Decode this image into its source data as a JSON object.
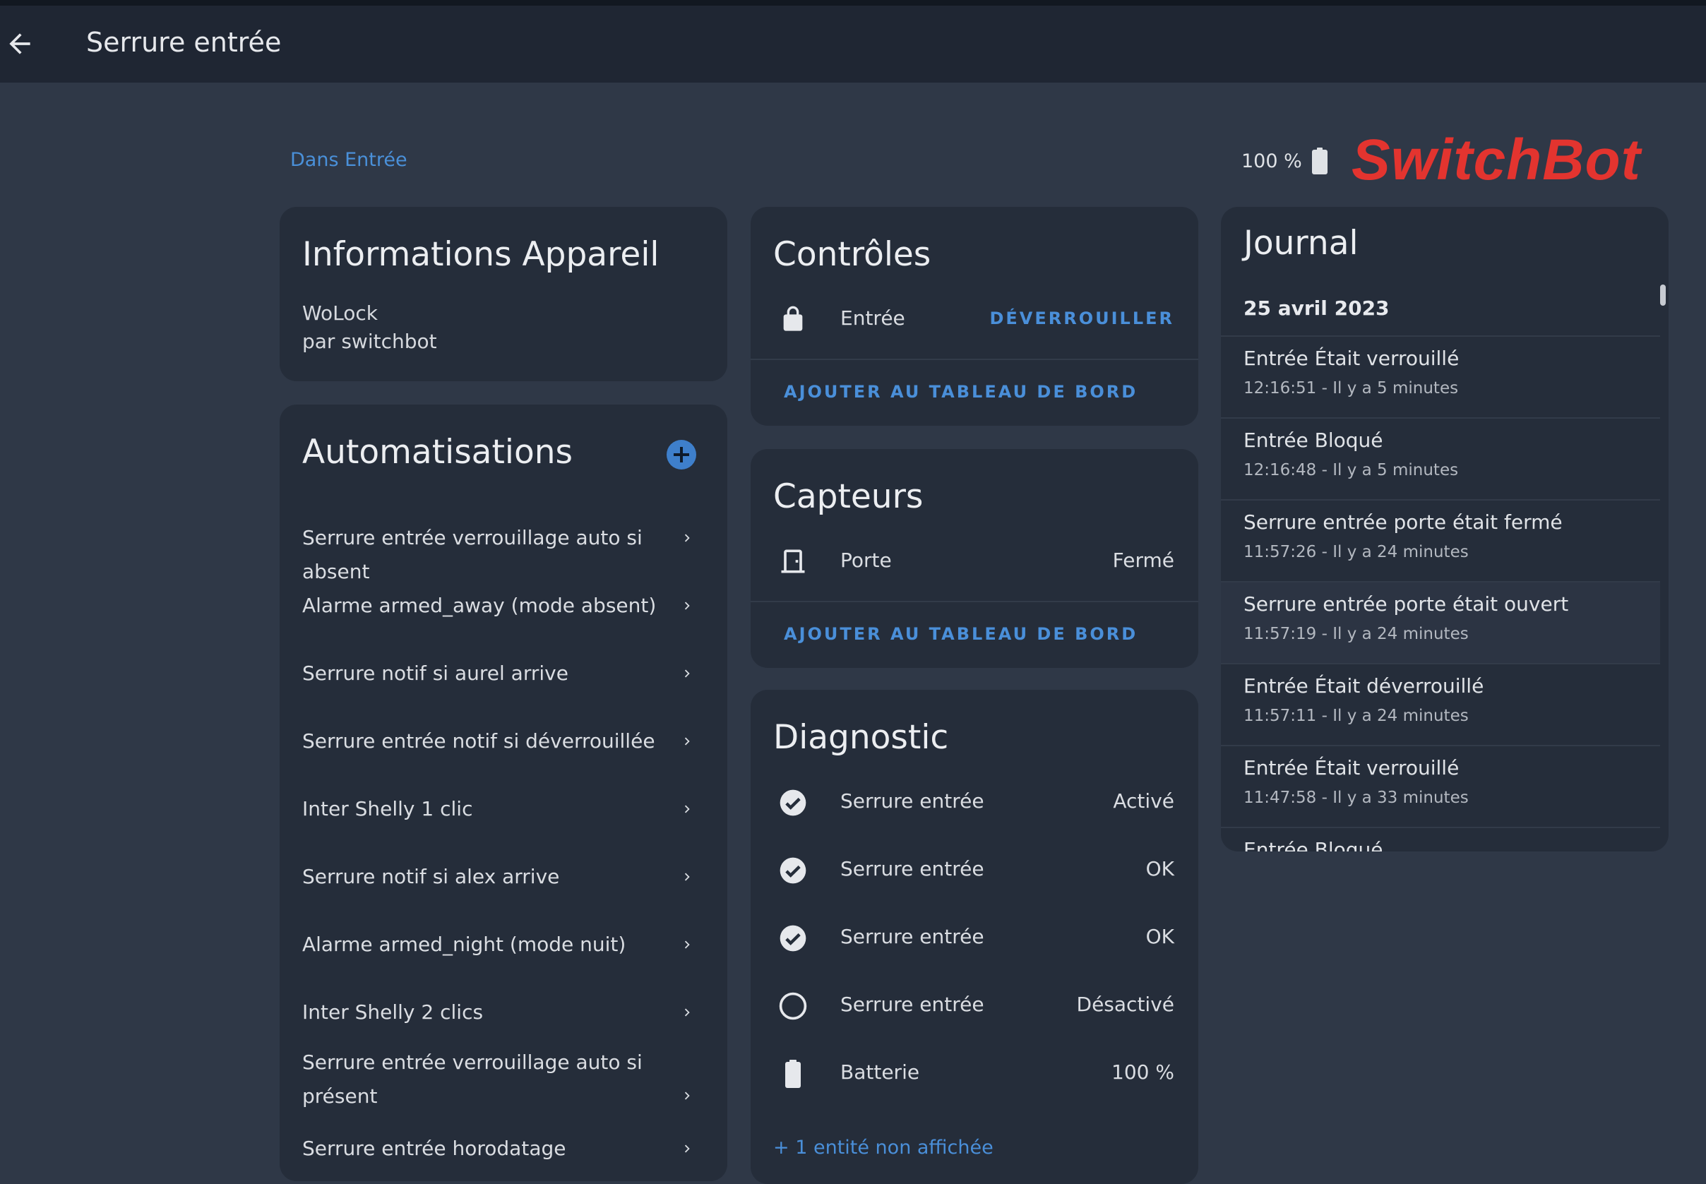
{
  "app": {
    "title": "Serrure entrée",
    "brand_logo": "SwitchBot"
  },
  "header": {
    "breadcrumb": "Dans Entrée",
    "battery_level": "100 %",
    "battery_icon": "battery-full-icon"
  },
  "device_info": {
    "title": "Informations Appareil",
    "model": "WoLock",
    "manufacturer": "par switchbot"
  },
  "automations": {
    "title": "Automatisations",
    "items": [
      "Serrure entrée verrouillage auto si absent",
      "Alarme armed_away (mode absent)",
      "Serrure notif si aurel arrive",
      "Serrure entrée notif si déverrouillée",
      "Inter Shelly 1 clic",
      "Serrure notif si alex arrive",
      "Alarme armed_night (mode nuit)",
      "Inter Shelly 2 clics",
      "Serrure entrée verrouillage auto si présent",
      "Serrure entrée horodatage"
    ]
  },
  "controls": {
    "title": "Contrôles",
    "entity_label": "Entrée",
    "action": "DÉVERROUILLER",
    "add_dashboard": "AJOUTER AU TABLEAU DE BORD"
  },
  "sensors": {
    "title": "Capteurs",
    "entity_label": "Porte",
    "entity_value": "Fermé",
    "add_dashboard": "AJOUTER AU TABLEAU DE BORD"
  },
  "diagnostic": {
    "title": "Diagnostic",
    "rows": [
      {
        "icon": "check-circle-icon",
        "label": "Serrure entrée",
        "value": "Activé"
      },
      {
        "icon": "check-circle-icon",
        "label": "Serrure entrée",
        "value": "OK"
      },
      {
        "icon": "check-circle-icon",
        "label": "Serrure entrée",
        "value": "OK"
      },
      {
        "icon": "circle-outline-icon",
        "label": "Serrure entrée",
        "value": "Désactivé"
      },
      {
        "icon": "battery-icon",
        "label": "Batterie",
        "value": "100 %"
      }
    ],
    "hidden_entities": "+ 1 entité non affichée"
  },
  "journal": {
    "title": "Journal",
    "date": "25 avril 2023",
    "entries": [
      {
        "title": "Entrée Était verrouillé",
        "time": "12:16:51 - Il y a 5 minutes"
      },
      {
        "title": "Entrée Bloqué",
        "time": "12:16:48 - Il y a 5 minutes"
      },
      {
        "title": "Serrure entrée porte était fermé",
        "time": "11:57:26 - Il y a 24 minutes"
      },
      {
        "title": "Serrure entrée porte était ouvert",
        "time": "11:57:19 - Il y a 24 minutes"
      },
      {
        "title": "Entrée Était déverrouillé",
        "time": "11:57:11 - Il y a 24 minutes"
      },
      {
        "title": "Entrée Était verrouillé",
        "time": "11:47:58 - Il y a 33 minutes"
      },
      {
        "title": "Entrée Bloqué",
        "time": ""
      }
    ]
  },
  "colors": {
    "accent": "#4a8fd9",
    "brand": "#e3342f",
    "background": "#2f3847",
    "card": "#252d3a"
  }
}
